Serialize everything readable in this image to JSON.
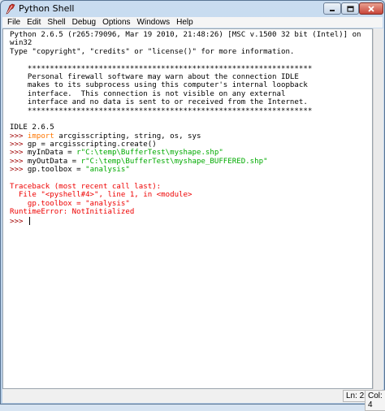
{
  "window": {
    "title": "Python Shell",
    "icons": {
      "app": "python-feather-icon",
      "minimize": "minimize-icon",
      "maximize": "maximize-icon",
      "close": "close-icon"
    }
  },
  "menu": [
    "File",
    "Edit",
    "Shell",
    "Debug",
    "Options",
    "Windows",
    "Help"
  ],
  "shell": {
    "header": [
      "Python 2.6.5 (r265:79096, Mar 19 2010, 21:48:26) [MSC v.1500 32 bit (Intel)] on",
      "win32",
      "Type \"copyright\", \"credits\" or \"license()\" for more information."
    ],
    "firewall_notice": [
      "    ****************************************************************",
      "    Personal firewall software may warn about the connection IDLE",
      "    makes to its subprocess using this computer's internal loopback",
      "    interface.  This connection is not visible on any external",
      "    interface and no data is sent to or received from the Internet.",
      "    ****************************************************************"
    ],
    "idle_version": "IDLE 2.6.5",
    "prompt": ">>> ",
    "commands": [
      [
        {
          "t": "import",
          "c": "kw"
        },
        {
          "t": " arcgisscripting, string, os, sys",
          "c": ""
        }
      ],
      [
        {
          "t": "gp = arcgisscripting.create()",
          "c": ""
        }
      ],
      [
        {
          "t": "myInData = ",
          "c": ""
        },
        {
          "t": "r\"C:\\temp\\BufferTest\\myshape.shp\"",
          "c": "str"
        }
      ],
      [
        {
          "t": "myOutData = ",
          "c": ""
        },
        {
          "t": "r\"C:\\temp\\BufferTest\\myshape_BUFFERED.shp\"",
          "c": "str"
        }
      ],
      [
        {
          "t": "gp.toolbox = ",
          "c": ""
        },
        {
          "t": "\"analysis\"",
          "c": "str"
        }
      ]
    ],
    "traceback": [
      "Traceback (most recent call last):",
      "  File \"<pyshell#4>\", line 1, in <module>",
      "    gp.toolbox = \"analysis\"",
      "RuntimeError: NotInitialized"
    ]
  },
  "status": {
    "line": "Ln: 22",
    "col": "Col: 4"
  }
}
